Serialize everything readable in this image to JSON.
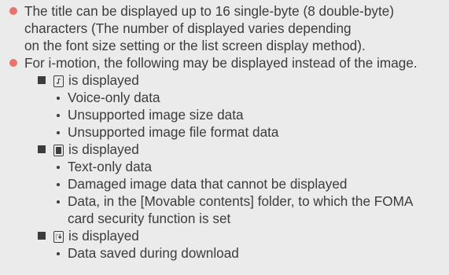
{
  "notes": [
    {
      "lines": [
        "The title can be displayed up to 16 single-byte (8 double-byte)",
        "characters (The number of displayed varies depending",
        "on the font size setting or the list screen display method)."
      ]
    },
    {
      "lines": [
        "For i-motion, the following may be displayed instead of the image."
      ],
      "groups": [
        {
          "icon": "music-note-file-icon",
          "label": "is displayed",
          "items": [
            [
              "Voice-only data"
            ],
            [
              "Unsupported image size data"
            ],
            [
              "Unsupported image file format data"
            ]
          ]
        },
        {
          "icon": "text-only-file-icon",
          "label": "is displayed",
          "items": [
            [
              "Text-only data"
            ],
            [
              "Damaged image data that cannot be displayed"
            ],
            [
              "Data, in the [Movable contents] folder, to which the FOMA",
              "card security function is set"
            ]
          ]
        },
        {
          "icon": "partial-download-file-icon",
          "label": "is displayed",
          "items": [
            [
              "Data saved during download"
            ]
          ]
        }
      ]
    }
  ]
}
